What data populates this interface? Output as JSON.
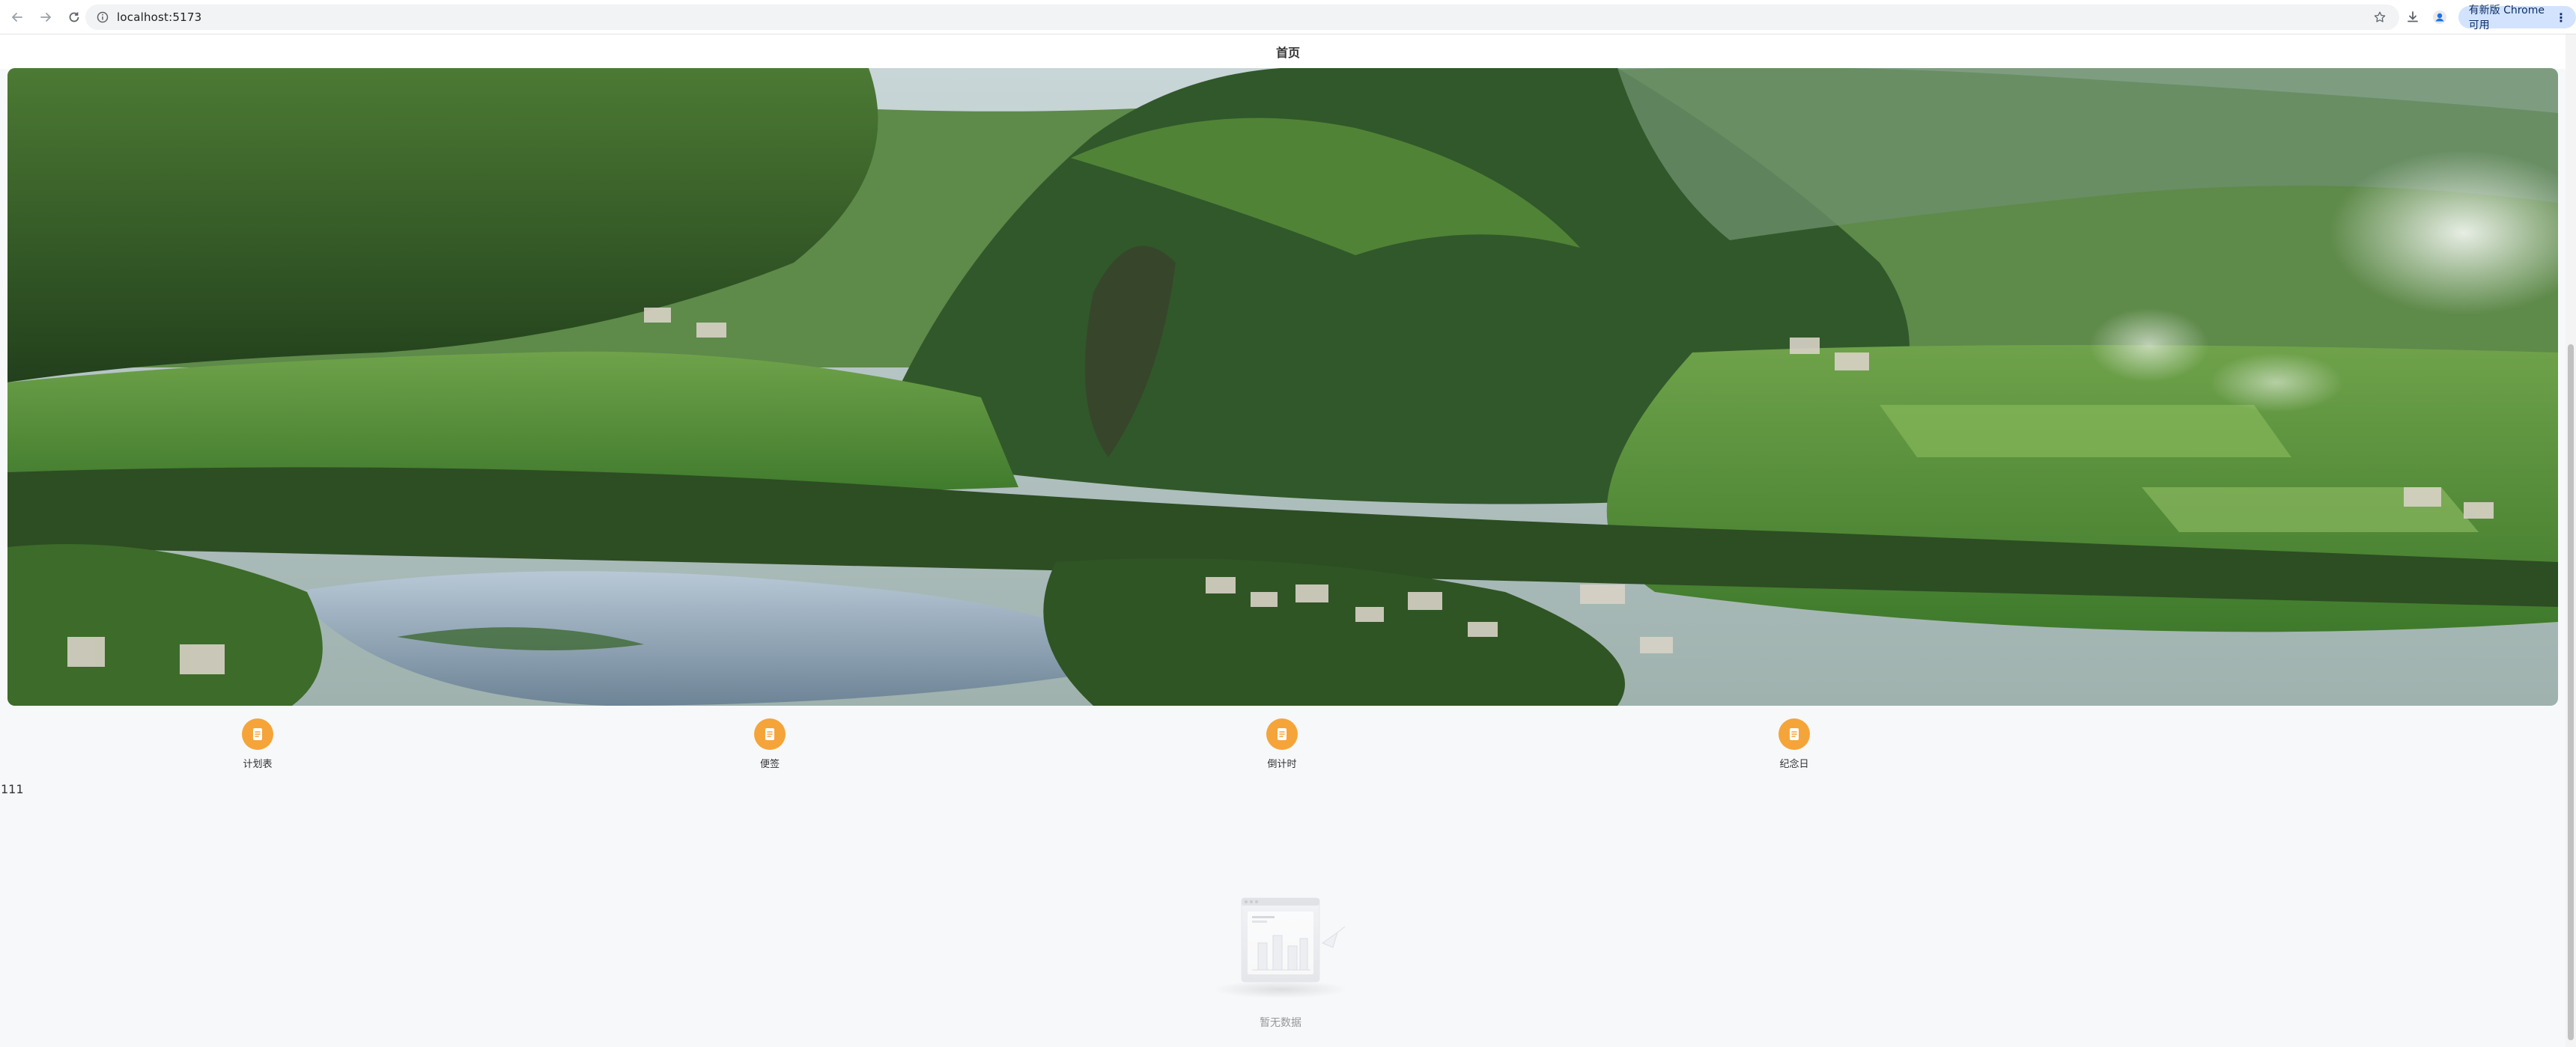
{
  "browser": {
    "url": "localhost:5173",
    "update_label": "有新版 Chrome 可用"
  },
  "navbar": {
    "title": "首页"
  },
  "entries": [
    {
      "label": "计划表",
      "icon": "notes-icon"
    },
    {
      "label": "便签",
      "icon": "notes-icon"
    },
    {
      "label": "倒计时",
      "icon": "notes-icon"
    },
    {
      "label": "纪念日",
      "icon": "notes-icon"
    }
  ],
  "list": {
    "text": "111"
  },
  "empty": {
    "description": "暂无数据"
  },
  "colors": {
    "accent": "#f5a43a",
    "background": "#f7f8fa"
  }
}
